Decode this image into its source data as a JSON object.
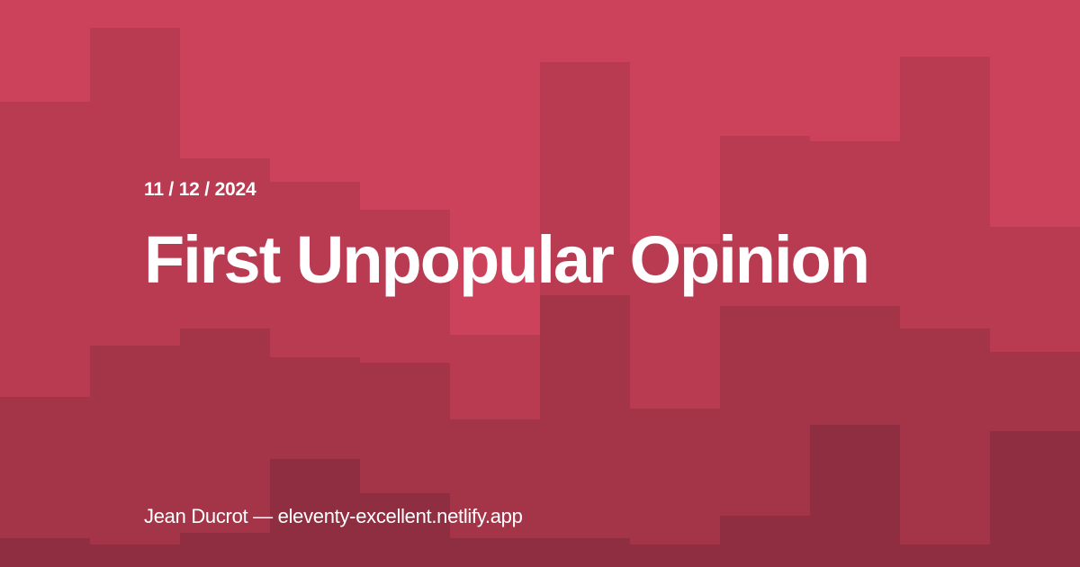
{
  "card": {
    "date": "11 / 12 / 2024",
    "title": "First Unpopular Opinion",
    "footer": "Jean Ducrot — eleventy-excellent.netlify.app"
  },
  "colors": {
    "base": "#cd425b",
    "layer1": "#b93b52",
    "layer2": "#a43548",
    "layer3": "#8e2e40",
    "text": "#ffffff"
  },
  "decoration": {
    "tiers": [
      [
        0.82,
        0.95,
        0.72,
        0.68,
        0.63,
        0.41,
        0.89,
        0.57,
        0.76,
        0.75,
        0.9,
        0.6
      ],
      [
        0.3,
        0.39,
        0.42,
        0.37,
        0.36,
        0.26,
        0.48,
        0.28,
        0.46,
        0.46,
        0.42,
        0.38
      ],
      [
        0.05,
        0.04,
        0.06,
        0.19,
        0.13,
        0.05,
        0.05,
        0.04,
        0.09,
        0.25,
        0.04,
        0.24
      ]
    ]
  }
}
